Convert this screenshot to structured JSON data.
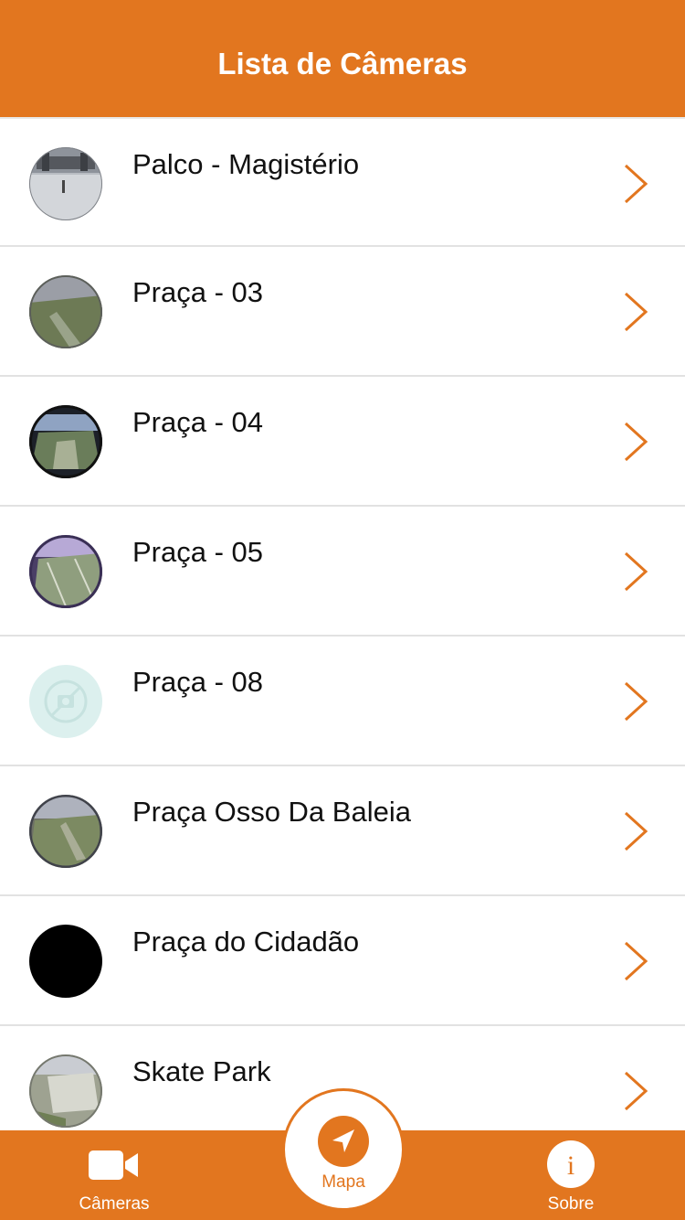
{
  "header": {
    "title": "Lista de Câmeras"
  },
  "cameras": [
    {
      "label": "Palco - Magistério",
      "thumbnail": "scene-stage"
    },
    {
      "label": "Praça - 03",
      "thumbnail": "scene-grass-dim"
    },
    {
      "label": "Praça - 04",
      "thumbnail": "scene-fisheye-dark"
    },
    {
      "label": "Praça - 05",
      "thumbnail": "scene-fisheye-purple"
    },
    {
      "label": "Praça - 08",
      "thumbnail": "no-camera-placeholder-icon"
    },
    {
      "label": "Praça Osso Da Baleia",
      "thumbnail": "scene-grass-dim"
    },
    {
      "label": "Praça do Cidadão",
      "thumbnail": "black-feed"
    },
    {
      "label": "Skate Park",
      "thumbnail": "scene-skatepark"
    }
  ],
  "tabbar": {
    "cameras": {
      "label": "Câmeras",
      "icon": "video-camera-icon"
    },
    "map": {
      "label": "Mapa",
      "icon": "navigation-arrow-icon"
    },
    "about": {
      "label": "Sobre",
      "icon": "info-icon",
      "glyph": "i"
    }
  },
  "colors": {
    "accent": "#E2761F",
    "divider": "#E2E2E2",
    "text": "#111111"
  }
}
